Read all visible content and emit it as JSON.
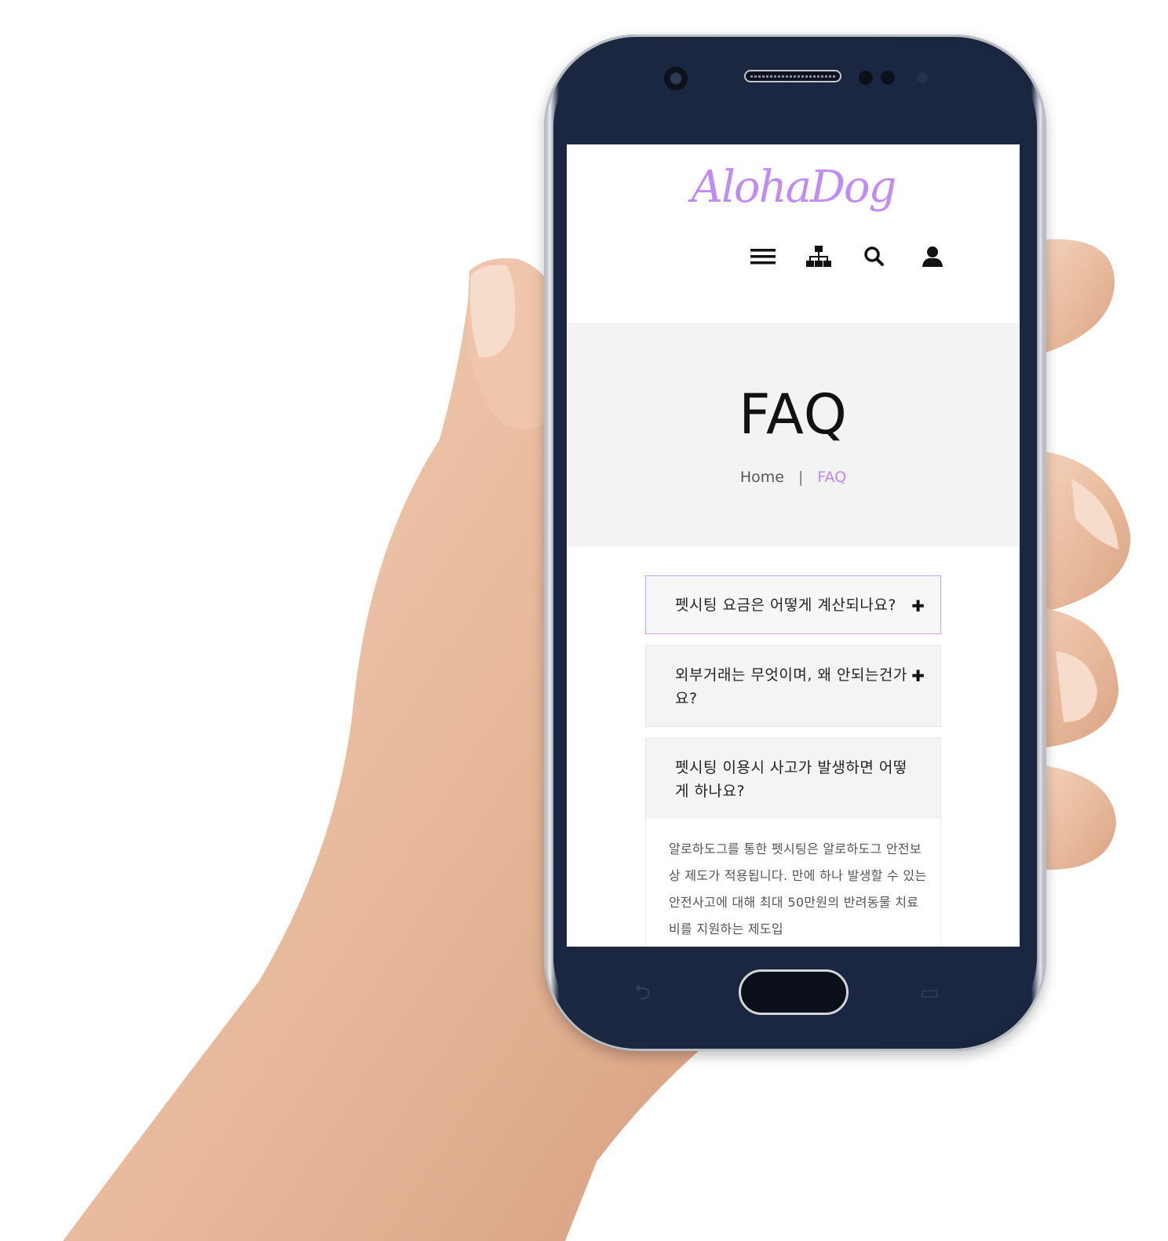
{
  "header": {
    "logo": "AlohaDog",
    "icons": [
      "menu-icon",
      "sitemap-icon",
      "search-icon",
      "user-icon"
    ]
  },
  "hero": {
    "title": "FAQ",
    "breadcrumb": {
      "home": "Home",
      "separator": "|",
      "current": "FAQ"
    }
  },
  "faq": {
    "items": [
      {
        "question": "펫시팅 요금은 어떻게 계산되나요?",
        "toggle": "✚"
      },
      {
        "question": "외부거래는 무엇이며, 왜 안되는건가요?",
        "toggle": "✚"
      },
      {
        "question": "펫시팅 이용시 사고가 발생하면 어떻게 하나요?",
        "toggle": ""
      }
    ],
    "open_answer": "알로하도그를 통한 펫시팅은 알로하도그 안전보상 제도가 적용됩니다. 만에 하나 발생할 수 있는 안전사고에 대해 최대 50만원의 반려동물 치료비를 지원하는 제도입"
  },
  "colors": {
    "accent": "#bf8af0",
    "hero_bg": "#f3f3f3",
    "phone_body": "#1b2640"
  }
}
